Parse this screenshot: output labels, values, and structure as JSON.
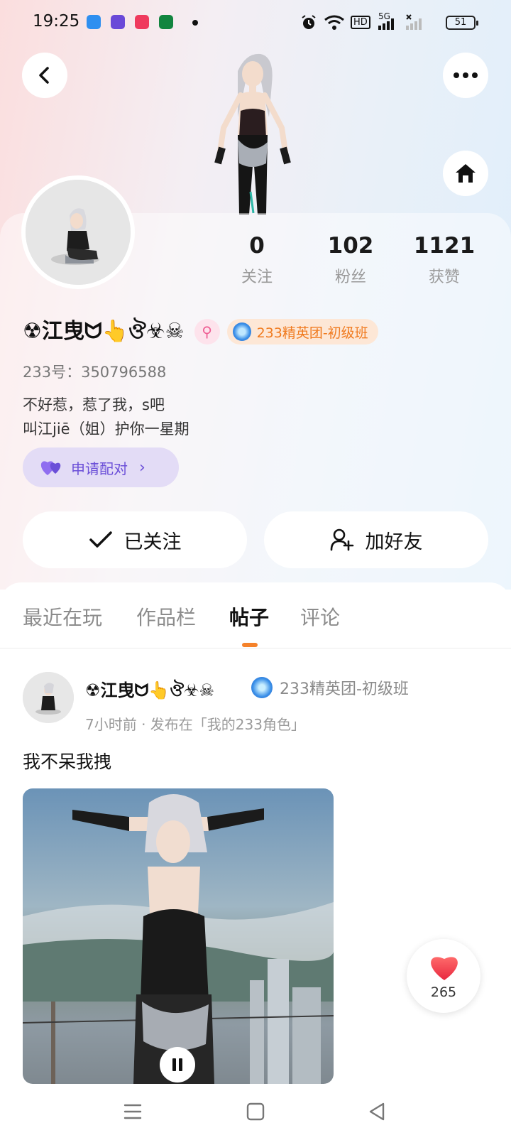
{
  "status_bar": {
    "time": "19:25",
    "network": "HD",
    "signal": "5G",
    "battery": "51",
    "icons": [
      "alarm-icon",
      "wifi-icon",
      "signal-icon"
    ]
  },
  "header": {
    "back_icon": "chevron-left-icon",
    "more_icon": "more-dots-icon",
    "home_icon": "home-icon"
  },
  "profile": {
    "stats": [
      {
        "value": "0",
        "label": "关注"
      },
      {
        "value": "102",
        "label": "粉丝"
      },
      {
        "value": "1121",
        "label": "获赞"
      }
    ],
    "name": "☢江曳ᗢ👆ঔ☣☠",
    "gender_symbol": "⚲",
    "badge_text": "233精英团-初级班",
    "uid": "233号：350796588",
    "bio_line1": "不好惹，惹了我，s吧",
    "bio_line2": "叫江jiē（姐）护你一星期",
    "pair_label": "申请配对",
    "follow_label": "已关注",
    "add_friend_label": "加好友"
  },
  "tabs": [
    {
      "label": "最近在玩",
      "active": false
    },
    {
      "label": "作品栏",
      "active": false
    },
    {
      "label": "帖子",
      "active": true
    },
    {
      "label": "评论",
      "active": false
    }
  ],
  "post": {
    "author": "☢江曳ᗢ👆ঔ☣☠",
    "badge_text": "233精英团-初级班",
    "meta": "7小时前 · 发布在「我的233角色」",
    "text": "我不呆我拽",
    "likes": "265"
  },
  "colors": {
    "accent": "#f5822a",
    "pair_purple": "#6b4fd8",
    "badge_orange": "#f07a1e"
  }
}
